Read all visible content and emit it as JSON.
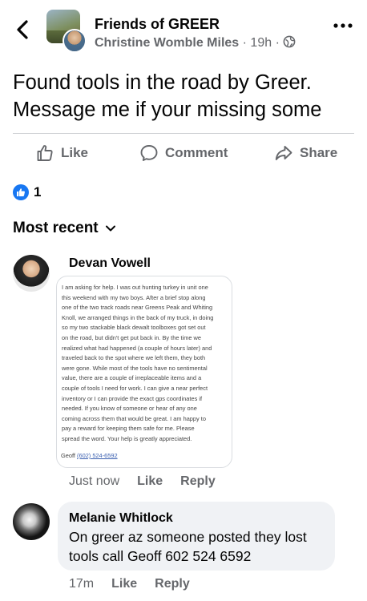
{
  "header": {
    "group_name": "Friends of GREER",
    "poster_name": "Christine Womble Miles",
    "separator": "·",
    "time": "19h",
    "icons": {
      "back": "chevron-left-icon",
      "privacy": "globe-icon",
      "more": "more-horizontal-icon"
    }
  },
  "post": {
    "text_line1": "Found tools in the road by Greer.",
    "text_line2": "Message me if your missing some"
  },
  "actions": {
    "like_label": "Like",
    "comment_label": "Comment",
    "share_label": "Share"
  },
  "reactions": {
    "count": "1",
    "color": "#1877f2"
  },
  "sort": {
    "label": "Most recent"
  },
  "comments": [
    {
      "author": "Devan Vowell",
      "image_text_lines": [
        "I am asking for help.  I was out hunting turkey in unit one",
        "this weekend with my two boys.  After a brief stop along",
        "one of the two track roads near Greens Peak and Whiting",
        "Knoll, we arranged things in the back of my truck, in doing",
        "so my two stackable black dewalt toolboxes got set out",
        "on the road, but didn't get put back in.  By the time we",
        "realized what had happened (a couple of hours later) and",
        "traveled back to the spot where we left them, they both",
        "were gone.  While most of the tools have no sentimental",
        "value, there are a couple of irreplaceable items and a",
        "couple of tools I need for work.  I can give a near perfect",
        "inventory or I can provide the exact gps coordinates if",
        "needed.  If you know of someone or hear of any one",
        "coming across them that would be great.  I am happy to",
        "pay a reward for keeping them safe for me.  Please",
        "spread the word.  Your help is greatly appreciated."
      ],
      "image_sig_name": "Geoff",
      "image_sig_phone": "(602) 524-6592",
      "time": "Just now",
      "like": "Like",
      "reply": "Reply"
    },
    {
      "author": "Melanie Whitlock",
      "text_line1": "On greer az someone posted they lost",
      "text_line2": "tools call Geoff 602 524 6592",
      "time": "17m",
      "like": "Like",
      "reply": "Reply"
    }
  ],
  "colors": {
    "secondary_text": "#65676b",
    "divider": "#ced0d4",
    "bubble": "#f0f2f5",
    "brand_blue": "#1877f2"
  }
}
